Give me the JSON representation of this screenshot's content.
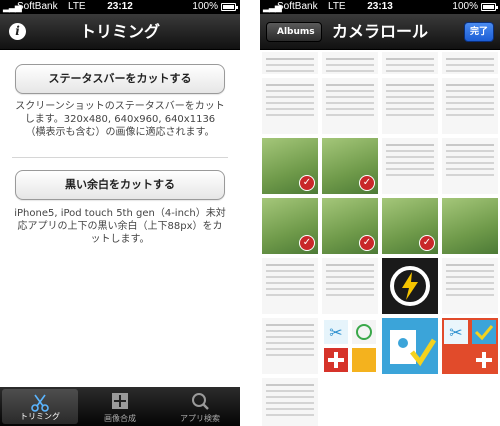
{
  "left_screen": {
    "statusbar": {
      "carrier": "SoftBank",
      "network": "LTE",
      "time": "23:12",
      "battery": "100%"
    },
    "navbar": {
      "title": "トリミング",
      "info_icon": "info-icon"
    },
    "button1": {
      "label": "ステータスバーをカットする"
    },
    "desc1": "スクリーンショットのステータスバーをカットします。320x480, 640x960, 640x1136\n（横表示も含む）の画像に適応されます。",
    "button2": {
      "label": "黒い余白をカットする"
    },
    "desc2": "iPhone5, iPod touch 5th gen（4-inch）未対応アプリの上下の黒い余白（上下88px）をカットします。",
    "tabs": [
      {
        "label": "トリミング",
        "icon": "scissors-icon",
        "active": true
      },
      {
        "label": "画像合成",
        "icon": "plus-square-icon",
        "active": false
      },
      {
        "label": "アプリ検索",
        "icon": "search-icon",
        "active": false
      }
    ]
  },
  "right_screen": {
    "statusbar": {
      "carrier": "SoftBank",
      "network": "LTE",
      "time": "23:13",
      "battery": "100%"
    },
    "navbar": {
      "title": "カメラロール",
      "back_label": "Albums",
      "done_label": "完了"
    }
  }
}
